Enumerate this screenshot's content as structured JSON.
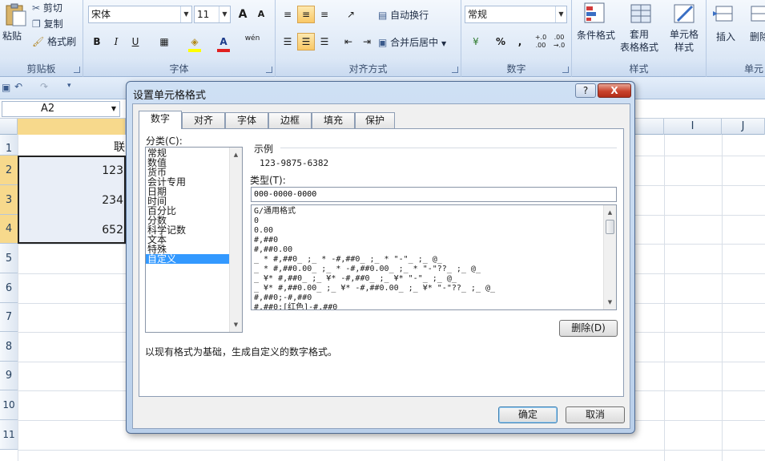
{
  "ribbon": {
    "clipboard": {
      "label": "剪贴板",
      "paste": "粘贴",
      "cut": "剪切",
      "copy": "复制",
      "format_painter": "格式刷"
    },
    "font": {
      "label": "字体",
      "font_name": "宋体",
      "font_size": "11",
      "bold": "B",
      "italic": "I",
      "underline": "U",
      "grow": "A",
      "shrink": "A",
      "phonetic": "wén"
    },
    "alignment": {
      "label": "对齐方式",
      "wrap": "自动换行",
      "merge": "合并后居中"
    },
    "number": {
      "label": "数字",
      "format": "常规",
      "percent": "%",
      "comma": ",",
      "inc": "+.0\n.00",
      "dec": ".00\n→.0"
    },
    "styles": {
      "label": "样式",
      "conditional": "条件格式",
      "table": "套用\n表格格式",
      "cell_styles": "单元格\n样式"
    },
    "cells": {
      "label": "单元",
      "insert": "插入",
      "delete": "删除"
    }
  },
  "formula_bar": {
    "name_box": "A2"
  },
  "sheet": {
    "columns": [
      "I",
      "J"
    ],
    "rows": [
      "1",
      "2",
      "3",
      "4",
      "5",
      "6",
      "7",
      "8",
      "9",
      "10",
      "11"
    ],
    "cells": {
      "b1": "联",
      "b2": "123",
      "b3": "234",
      "b4": "652"
    }
  },
  "dialog": {
    "title": "设置单元格格式",
    "help": "?",
    "close": "X",
    "tabs": [
      "数字",
      "对齐",
      "字体",
      "边框",
      "填充",
      "保护"
    ],
    "category_label": "分类(C):",
    "categories": [
      "常规",
      "数值",
      "货币",
      "会计专用",
      "日期",
      "时间",
      "百分比",
      "分数",
      "科学记数",
      "文本",
      "特殊",
      "自定义"
    ],
    "selected_category": "自定义",
    "sample_label": "示例",
    "sample_value": "123-9875-6382",
    "type_label": "类型(T):",
    "type_value": "000-0000-0000",
    "formats": [
      "G/通用格式",
      "0",
      "0.00",
      "#,##0",
      "#,##0.00",
      "_ * #,##0_ ;_ * -#,##0_ ;_ * \"-\"_ ;_ @_",
      "_ * #,##0.00_ ;_ * -#,##0.00_ ;_ * \"-\"??_ ;_ @_",
      "_ ¥* #,##0_ ;_ ¥* -#,##0_ ;_ ¥* \"-\"_ ;_ @_",
      "_ ¥* #,##0.00_ ;_ ¥* -#,##0.00_ ;_ ¥* \"-\"??_ ;_ @_",
      "#,##0;-#,##0",
      "#,##0;[红色]-#,##0"
    ],
    "delete_button": "删除(D)",
    "description": "以现有格式为基础，生成自定义的数字格式。",
    "ok_button": "确定",
    "cancel_button": "取消"
  },
  "colors": {
    "selection": "#3399ff",
    "close": "#c9432d"
  }
}
